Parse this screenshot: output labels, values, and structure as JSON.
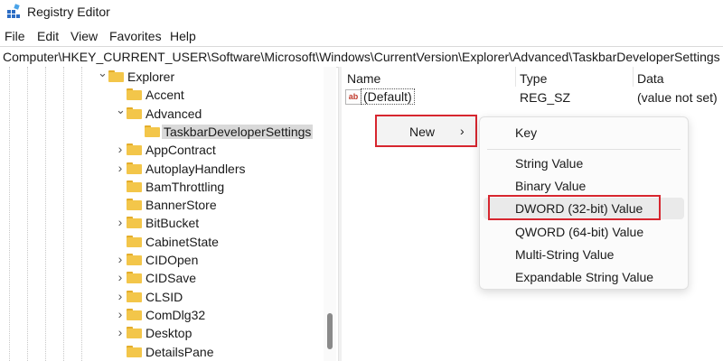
{
  "window": {
    "title": "Registry Editor"
  },
  "menu": {
    "items": [
      {
        "label": "File"
      },
      {
        "label": "Edit"
      },
      {
        "label": "View"
      },
      {
        "label": "Favorites"
      },
      {
        "label": "Help"
      }
    ]
  },
  "address": {
    "path": "Computer\\HKEY_CURRENT_USER\\Software\\Microsoft\\Windows\\CurrentVersion\\Explorer\\Advanced\\TaskbarDeveloperSettings"
  },
  "tree": {
    "items": [
      {
        "label": "Explorer",
        "expander": "expanded"
      },
      {
        "label": "Accent",
        "expander": "none"
      },
      {
        "label": "Advanced",
        "expander": "expanded"
      },
      {
        "label": "TaskbarDeveloperSettings",
        "expander": "none",
        "selected": true
      },
      {
        "label": "AppContract",
        "expander": "collapsed"
      },
      {
        "label": "AutoplayHandlers",
        "expander": "collapsed"
      },
      {
        "label": "BamThrottling",
        "expander": "none"
      },
      {
        "label": "BannerStore",
        "expander": "none"
      },
      {
        "label": "BitBucket",
        "expander": "collapsed"
      },
      {
        "label": "CabinetState",
        "expander": "none"
      },
      {
        "label": "CIDOpen",
        "expander": "collapsed"
      },
      {
        "label": "CIDSave",
        "expander": "collapsed"
      },
      {
        "label": "CLSID",
        "expander": "collapsed"
      },
      {
        "label": "ComDlg32",
        "expander": "collapsed"
      },
      {
        "label": "Desktop",
        "expander": "collapsed"
      },
      {
        "label": "DetailsPane",
        "expander": "none"
      }
    ]
  },
  "values": {
    "columns": {
      "name": "Name",
      "type": "Type",
      "data": "Data"
    },
    "rows": [
      {
        "name": "(Default)",
        "type": "REG_SZ",
        "data": "(value not set)",
        "icon": "string-value-icon"
      }
    ]
  },
  "context_menu": {
    "new_label": "New",
    "new_arrow": "›"
  },
  "submenu": {
    "items": [
      {
        "label": "Key"
      },
      {
        "label": "String Value"
      },
      {
        "label": "Binary Value"
      },
      {
        "label": "DWORD (32-bit) Value",
        "highlighted": true
      },
      {
        "label": "QWORD (64-bit) Value"
      },
      {
        "label": "Multi-String Value"
      },
      {
        "label": "Expandable String Value"
      }
    ]
  },
  "colors": {
    "highlight_border": "#d7262f",
    "folder": "#f3c64a",
    "selected_bg": "#d9d9d9"
  }
}
